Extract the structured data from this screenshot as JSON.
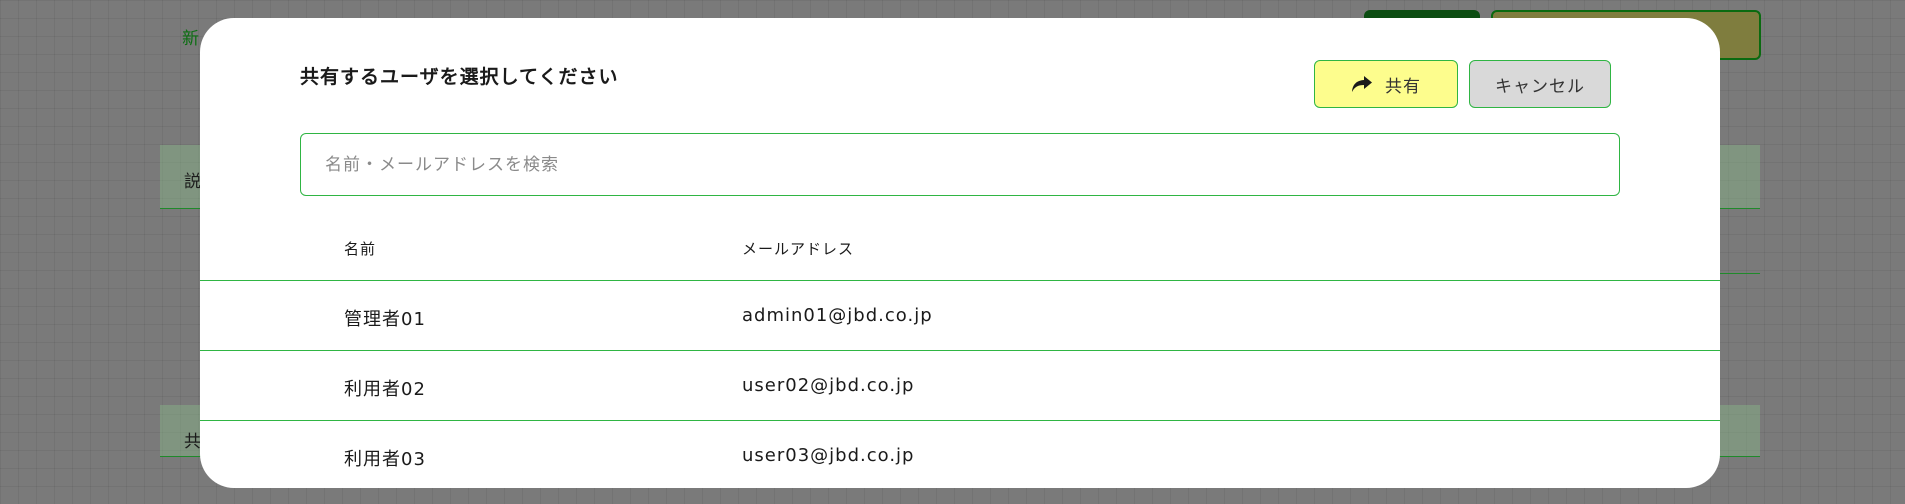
{
  "background": {
    "new_label": "新",
    "section1_label": "説",
    "section2_label": "共"
  },
  "modal": {
    "title": "共有するユーザを選択してください",
    "share_button": "共有",
    "cancel_button": "キャンセル",
    "search": {
      "placeholder": "名前・メールアドレスを検索",
      "value": ""
    },
    "columns": {
      "name": "名前",
      "email": "メールアドレス"
    },
    "users": [
      {
        "name": "管理者01",
        "email": "admin01@jbd.co.jp"
      },
      {
        "name": "利用者02",
        "email": "user02@jbd.co.jp"
      },
      {
        "name": "利用者03",
        "email": "user03@jbd.co.jp"
      }
    ]
  },
  "colors": {
    "accent_green": "#2fb543",
    "share_bg": "#fdfd8d",
    "cancel_bg": "#d9d9d9",
    "overlay": "#7a7a7a"
  }
}
